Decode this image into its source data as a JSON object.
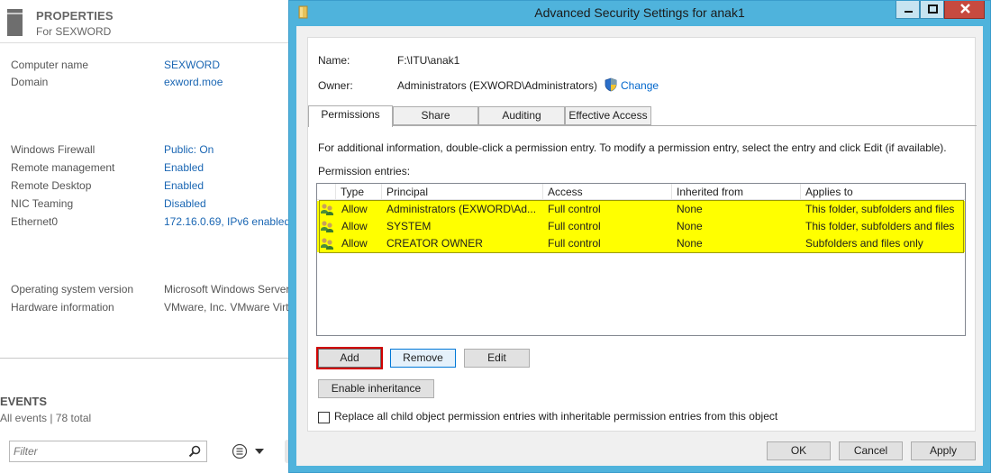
{
  "background": {
    "properties": {
      "title": "PROPERTIES",
      "subtitle": "For SEXWORD",
      "rows": [
        {
          "label": "Computer name",
          "value": "SEXWORD",
          "link": true
        },
        {
          "label": "Domain",
          "value": "exword.moe",
          "link": true
        },
        {
          "label": "Windows Firewall",
          "value": "Public: On",
          "link": true
        },
        {
          "label": "Remote management",
          "value": "Enabled",
          "link": true
        },
        {
          "label": "Remote Desktop",
          "value": "Enabled",
          "link": true
        },
        {
          "label": "NIC Teaming",
          "value": "Disabled",
          "link": true
        },
        {
          "label": "Ethernet0",
          "value": "172.16.0.69, IPv6 enabled",
          "link": true
        },
        {
          "label": "Operating system version",
          "value": "Microsoft Windows Server",
          "link": false
        },
        {
          "label": "Hardware information",
          "value": "VMware, Inc. VMware Virtu",
          "link": false
        }
      ]
    },
    "events": {
      "title": "EVENTS",
      "subtitle": "All events | 78 total",
      "filter_placeholder": "Filter"
    }
  },
  "dialog": {
    "title": "Advanced Security Settings for anak1",
    "name_label": "Name:",
    "name_value": "F:\\ITU\\anak1",
    "owner_label": "Owner:",
    "owner_value": "Administrators (EXWORD\\Administrators)",
    "change_link": "Change",
    "tabs": [
      {
        "label": "Permissions",
        "active": true
      },
      {
        "label": "Share",
        "active": false
      },
      {
        "label": "Auditing",
        "active": false
      },
      {
        "label": "Effective Access",
        "active": false
      }
    ],
    "info_text": "For additional information, double-click a permission entry. To modify a permission entry, select the entry and click Edit (if available).",
    "entries_label": "Permission entries:",
    "columns": [
      "Type",
      "Principal",
      "Access",
      "Inherited from",
      "Applies to"
    ],
    "entries": [
      {
        "type": "Allow",
        "principal": "Administrators (EXWORD\\Ad...",
        "access": "Full control",
        "inherited": "None",
        "applies": "This folder, subfolders and files"
      },
      {
        "type": "Allow",
        "principal": "SYSTEM",
        "access": "Full control",
        "inherited": "None",
        "applies": "This folder, subfolders and files"
      },
      {
        "type": "Allow",
        "principal": "CREATOR OWNER",
        "access": "Full control",
        "inherited": "None",
        "applies": "Subfolders and files only"
      }
    ],
    "buttons": {
      "add": "Add",
      "remove": "Remove",
      "edit": "Edit",
      "enable_inheritance": "Enable inheritance",
      "ok": "OK",
      "cancel": "Cancel",
      "apply": "Apply"
    },
    "replace_checkbox_label": "Replace all child object permission entries with inheritable permission entries from this object",
    "replace_checked": false,
    "highlight_color": "#ffff00",
    "add_outline_color": "#d00000"
  }
}
